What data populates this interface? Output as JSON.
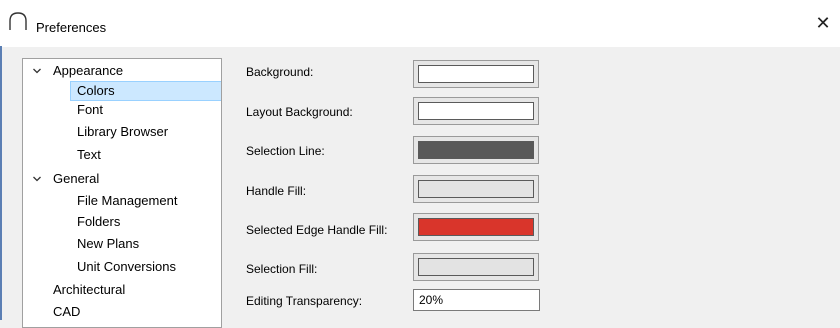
{
  "window": {
    "title": "Preferences",
    "close_glyph": "✕"
  },
  "tree": {
    "items": [
      {
        "label": "Appearance",
        "level": 0,
        "expanded": true
      },
      {
        "label": "Colors",
        "level": 1,
        "selected": true
      },
      {
        "label": "Font",
        "level": 1
      },
      {
        "label": "Library Browser",
        "level": 1
      },
      {
        "label": "Text",
        "level": 1
      },
      {
        "label": "General",
        "level": 0,
        "expanded": true
      },
      {
        "label": "File Management",
        "level": 1
      },
      {
        "label": "Folders",
        "level": 1
      },
      {
        "label": "New Plans",
        "level": 1
      },
      {
        "label": "Unit Conversions",
        "level": 1
      },
      {
        "label": "Architectural",
        "level": 0
      },
      {
        "label": "CAD",
        "level": 0
      }
    ]
  },
  "colors_panel": {
    "background_label": "Background:",
    "background_color": "#ffffff",
    "layout_background_label": "Layout Background:",
    "layout_background_color": "#ffffff",
    "selection_line_label": "Selection Line:",
    "selection_line_color": "#595959",
    "handle_fill_label": "Handle Fill:",
    "handle_fill_color": "#e3e3e3",
    "selected_edge_handle_fill_label": "Selected Edge Handle Fill:",
    "selected_edge_handle_fill_color": "#d9352b",
    "selection_fill_label": "Selection Fill:",
    "selection_fill_color": "#e3e3e3",
    "editing_transparency_label": "Editing Transparency:",
    "editing_transparency_value": "20%"
  },
  "accent_color": "#5b7fb4"
}
